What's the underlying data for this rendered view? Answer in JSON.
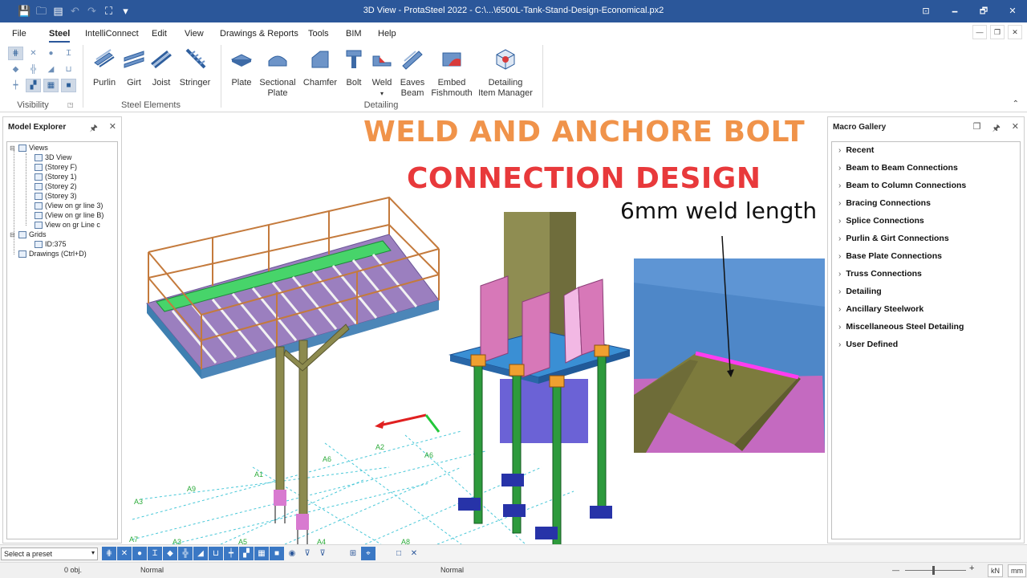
{
  "window": {
    "title": "3D View - ProtaSteel 2022 - C:\\...\\6500L-Tank-Stand-Design-Economical.px2",
    "minimize": "🗕",
    "restore": "🗗",
    "close": "✕",
    "options": "⊡"
  },
  "qat": {
    "save": "💾",
    "open": "🗀",
    "template": "▤",
    "undo": "↶",
    "redo": "↷",
    "fit": "⛶",
    "more": "▾"
  },
  "tabs": [
    "File",
    "Steel",
    "IntelliConnect",
    "Edit",
    "View",
    "Drawings & Reports",
    "Tools",
    "BIM",
    "Help"
  ],
  "mdi": [
    "—",
    "❐",
    "✕"
  ],
  "ribbon": {
    "visibility_label": "Visibility",
    "steel_elements_label": "Steel Elements",
    "detailing_label": "Detailing",
    "steel_elements": [
      {
        "line1": "Purlin",
        "line2": ""
      },
      {
        "line1": "Girt",
        "line2": ""
      },
      {
        "line1": "Joist",
        "line2": ""
      },
      {
        "line1": "Stringer",
        "line2": ""
      }
    ],
    "detailing": [
      {
        "line1": "Plate",
        "line2": ""
      },
      {
        "line1": "Sectional",
        "line2": "Plate"
      },
      {
        "line1": "Chamfer",
        "line2": ""
      },
      {
        "line1": "Bolt",
        "line2": ""
      },
      {
        "line1": "Weld",
        "line2": "▾"
      },
      {
        "line1": "Eaves",
        "line2": "Beam"
      },
      {
        "line1": "Embed",
        "line2": "Fishmouth"
      },
      {
        "line1": "Detailing",
        "line2": "Item Manager"
      }
    ],
    "collapse": "⌃"
  },
  "model_explorer": {
    "title": "Model Explorer",
    "pin": "🖈",
    "close": "✕",
    "views_label": "Views",
    "views": [
      "3D View",
      "(Storey F)",
      "(Storey 1)",
      "(Storey 2)",
      "(Storey 3)",
      "(View on gr line 3)",
      "(View on gr line B)",
      "View on gr Line c"
    ],
    "grids_label": "Grids",
    "grid_items": [
      "ID:375"
    ],
    "drawings_label": "Drawings (Ctrl+D)"
  },
  "macro_gallery": {
    "title": "Macro Gallery",
    "items": [
      "Recent",
      "Beam to Beam Connections",
      "Beam to Column Connections",
      "Bracing Connections",
      "Splice Connections",
      "Purlin & Girt Connections",
      "Base Plate Connections",
      "Truss Connections",
      "Detailing",
      "Ancillary Steelwork",
      "Miscellaneous Steel Detailing",
      "User Defined"
    ]
  },
  "viewport": {
    "headline1": "WELD AND ANCHORE BOLT",
    "headline2": "CONNECTION DESIGN",
    "weld_label": "6mm weld length",
    "grid_labels": [
      {
        "t": "A1"
      },
      {
        "t": "A2"
      },
      {
        "t": "A3"
      },
      {
        "t": "A6"
      },
      {
        "t": "A6"
      },
      {
        "t": "A9"
      },
      {
        "t": "A7"
      },
      {
        "t": "A3"
      },
      {
        "t": "A5"
      },
      {
        "t": "A4"
      },
      {
        "t": "A8"
      },
      {
        "t": "A6"
      }
    ]
  },
  "bottom": {
    "preset": "Select a preset",
    "objects": "0 obj.",
    "mode1": "Normal",
    "mode2": "Normal",
    "unit_force": "kN",
    "unit_length": "mm",
    "zoom_minus": "—",
    "zoom_plus": "+"
  },
  "colors": {
    "title_bar": "#2b579a",
    "headline1": "#f0934a",
    "headline2": "#e8393b",
    "weld": "#ff3df0"
  }
}
